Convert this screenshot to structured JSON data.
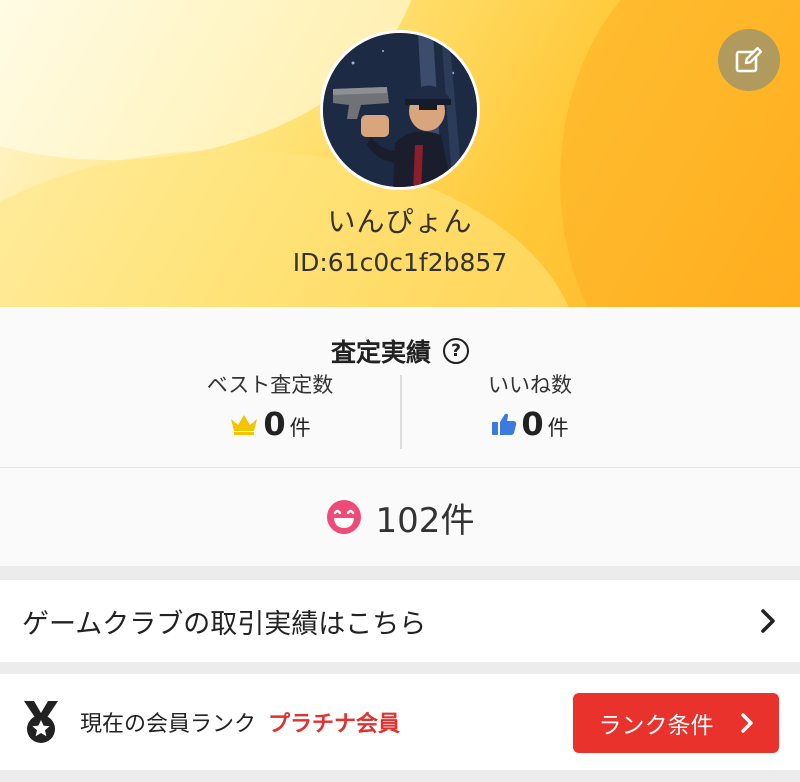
{
  "profile": {
    "username": "いんぴょん",
    "id_label": "ID:61c0c1f2b857"
  },
  "stats": {
    "title": "査定実績",
    "help_symbol": "?",
    "best": {
      "label": "ベスト査定数",
      "value": "0",
      "unit": "件",
      "icon": "crown-icon",
      "color": "#f5c400"
    },
    "likes": {
      "label": "いいね数",
      "value": "0",
      "unit": "件",
      "icon": "thumbs-up-icon",
      "color": "#3b7be0"
    }
  },
  "smile": {
    "count": "102件",
    "icon": "grinning-face-icon",
    "color": "#ee4b79"
  },
  "trade_link": {
    "label": "ゲームクラブの取引実績はこちら"
  },
  "rank": {
    "label": "現在の会員ランク",
    "value": "プラチナ会員",
    "button_label": "ランク条件",
    "icon": "medal-icon",
    "accent": "#e8322b"
  },
  "icons": {
    "edit": "edit-icon",
    "chevron": "chevron-right-icon"
  }
}
